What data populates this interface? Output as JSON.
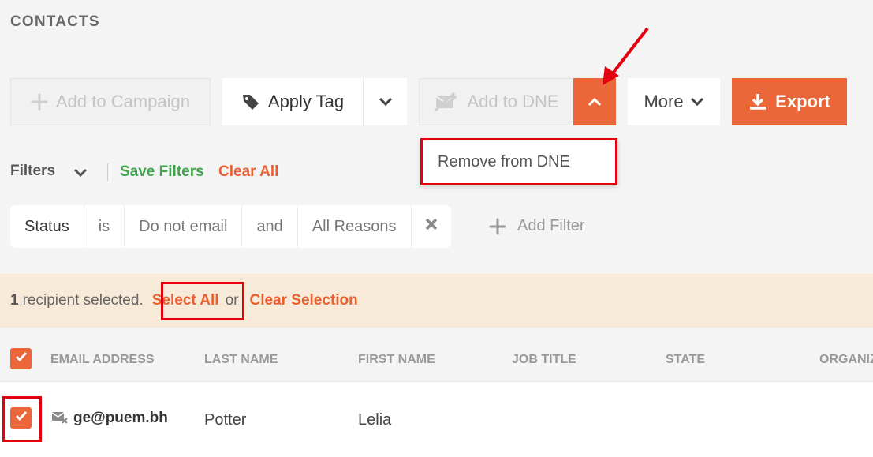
{
  "page": {
    "title": "CONTACTS"
  },
  "toolbar": {
    "add_to_campaign": "Add to Campaign",
    "apply_tag": "Apply Tag",
    "add_to_dne": "Add to DNE",
    "more": "More",
    "export": "Export"
  },
  "dne_menu": {
    "remove_from_dne": "Remove from DNE"
  },
  "filters": {
    "label": "Filters",
    "save": "Save Filters",
    "clear": "Clear All",
    "chips": [
      "Status",
      "is",
      "Do not email",
      "and",
      "All Reasons"
    ],
    "add": "Add Filter"
  },
  "selection": {
    "count": "1",
    "text": "recipient selected.",
    "select_all": "Select All",
    "or": "or",
    "clear": "Clear Selection"
  },
  "table": {
    "headers": [
      "EMAIL ADDRESS",
      "LAST NAME",
      "FIRST NAME",
      "JOB TITLE",
      "STATE",
      "ORGANIZ"
    ],
    "rows": [
      {
        "email": "ge@puem.bh",
        "last": "Potter",
        "first": "Lelia"
      }
    ]
  },
  "colors": {
    "accent": "#eb6639",
    "green": "#3ea649",
    "highlight": "#e3000f",
    "selection_bg": "#f8ead8"
  },
  "icons": [
    "plus-icon",
    "tag-icon",
    "chevron-down-icon",
    "dne-icon",
    "chevron-up-icon",
    "download-icon",
    "close-icon",
    "check-icon",
    "email-blocked-icon"
  ]
}
